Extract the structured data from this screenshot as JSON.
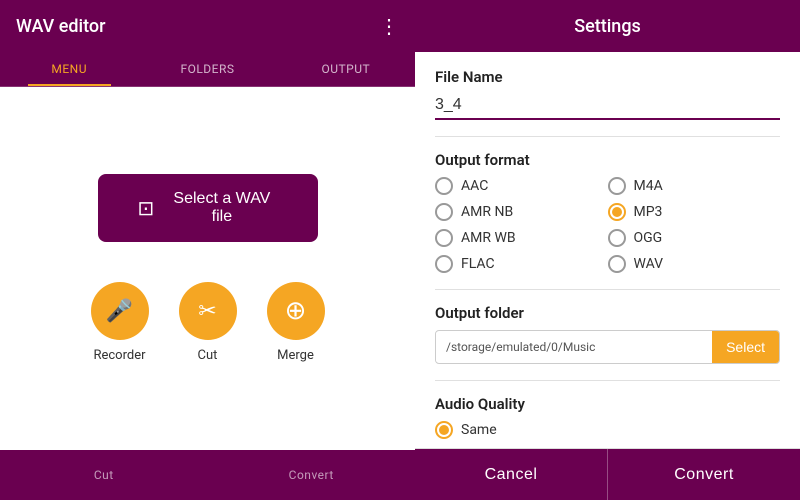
{
  "left": {
    "header": {
      "title": "WAV editor",
      "more_icon": "⋮"
    },
    "tabs": [
      {
        "id": "menu",
        "label": "MENU",
        "active": true
      },
      {
        "id": "folders",
        "label": "FOLDERS",
        "active": false
      },
      {
        "id": "output",
        "label": "OUTPUT",
        "active": false
      }
    ],
    "select_btn": {
      "label": "Select a WAV file",
      "icon": "⊡"
    },
    "tools": [
      {
        "id": "recorder",
        "label": "Recorder",
        "icon": "🎤"
      },
      {
        "id": "cut",
        "label": "Cut",
        "icon": "✂"
      },
      {
        "id": "merge",
        "label": "Merge",
        "icon": "⊕"
      }
    ],
    "bottom_nav": [
      {
        "id": "cut",
        "label": "Cut"
      },
      {
        "id": "convert",
        "label": "Convert"
      }
    ]
  },
  "right": {
    "header": {
      "title": "Settings"
    },
    "file_name": {
      "label": "File Name",
      "value": "3_4"
    },
    "output_format": {
      "label": "Output format",
      "options": [
        {
          "id": "aac",
          "label": "AAC",
          "checked": false
        },
        {
          "id": "m4a",
          "label": "M4A",
          "checked": false
        },
        {
          "id": "amr_nb",
          "label": "AMR NB",
          "checked": false
        },
        {
          "id": "mp3",
          "label": "MP3",
          "checked": true
        },
        {
          "id": "amr_wb",
          "label": "AMR WB",
          "checked": false
        },
        {
          "id": "ogg",
          "label": "OGG",
          "checked": false
        },
        {
          "id": "flac",
          "label": "FLAC",
          "checked": false
        },
        {
          "id": "wav",
          "label": "WAV",
          "checked": false
        }
      ]
    },
    "output_folder": {
      "label": "Output folder",
      "path": "/storage/emulated/0/Music",
      "select_label": "Select"
    },
    "audio_quality": {
      "label": "Audio Quality",
      "options": [
        {
          "id": "same",
          "label": "Same",
          "checked": true
        }
      ]
    },
    "footer": {
      "cancel_label": "Cancel",
      "convert_label": "Convert"
    }
  }
}
